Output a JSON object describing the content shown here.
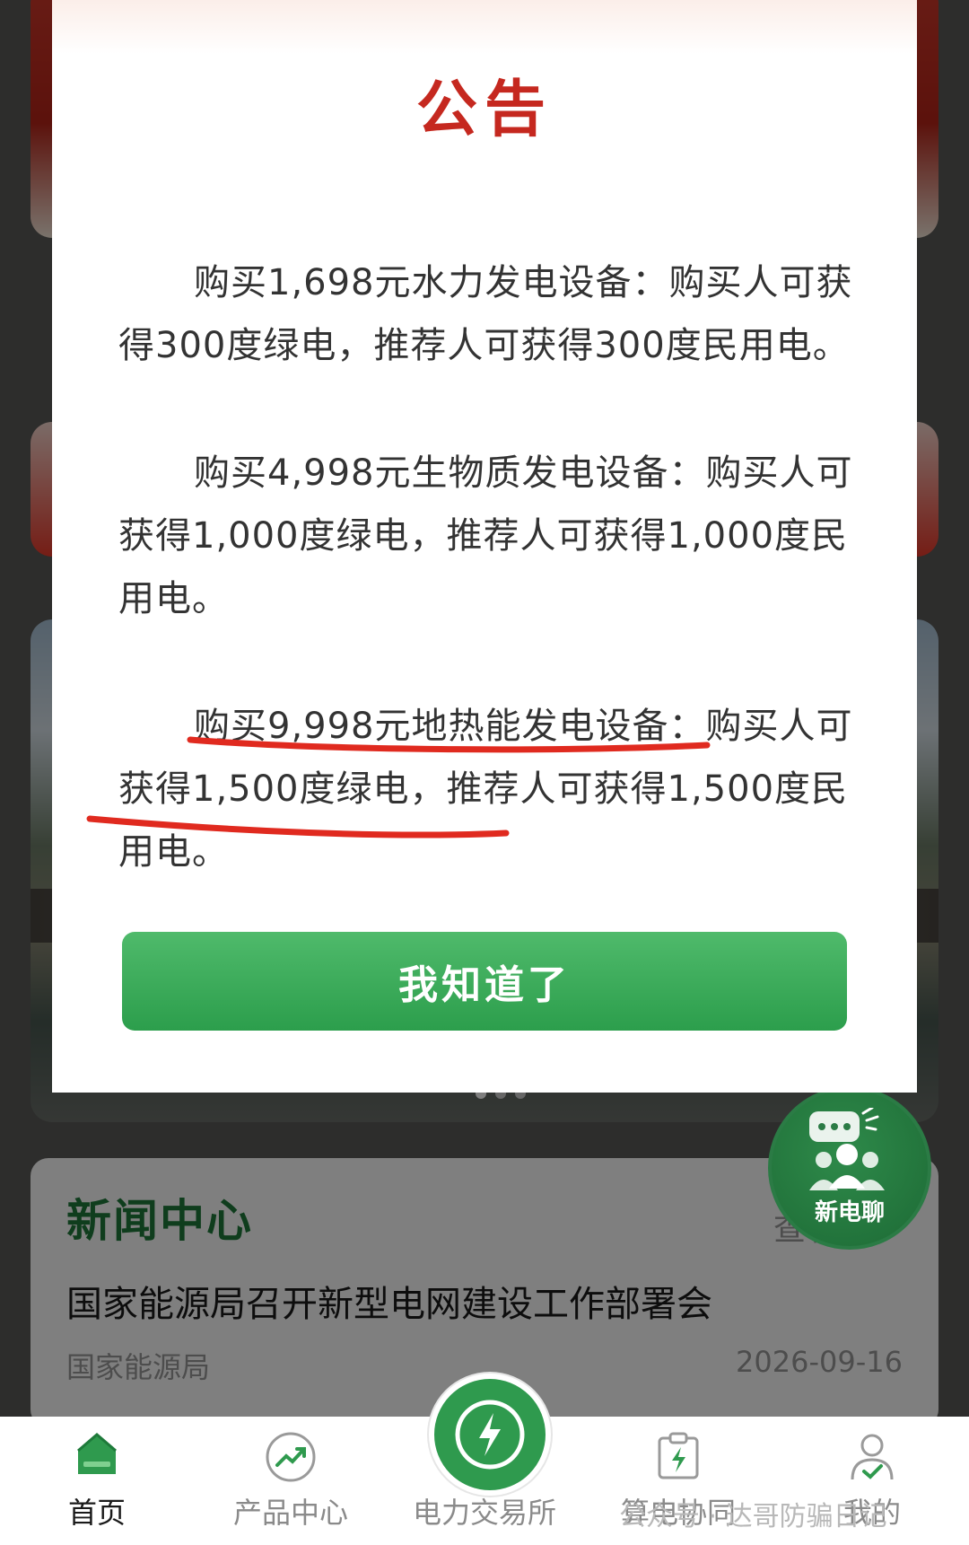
{
  "modal": {
    "title": "公告",
    "paragraphs": [
      "购买1,698元水力发电设备：购买人可获得300度绿电，推荐人可获得300度民用电。",
      "购买4,998元生物质发电设备：购买人可获得1,000度绿电，推荐人可获得1,000度民用电。",
      "购买9,998元地热能发电设备：购买人可获得1,500度绿电，推荐人可获得1,500度民用电。"
    ],
    "confirm_label": "我知道了"
  },
  "chat_fab": {
    "label": "新电聊"
  },
  "news": {
    "title": "新闻中心",
    "more_label": "查看更多",
    "headline": "国家能源局召开新型电网建设工作部署会",
    "source": "国家能源局",
    "date": "2026-09-16"
  },
  "tabs": [
    {
      "label": "首页",
      "icon": "home-icon",
      "active": true
    },
    {
      "label": "产品中心",
      "icon": "trend-chart-icon",
      "active": false
    },
    {
      "label": "电力交易所",
      "icon": "lightning-icon",
      "active": false
    },
    {
      "label": "算电协同",
      "icon": "clipboard-lightning-icon",
      "active": false
    },
    {
      "label": "我的",
      "icon": "user-check-icon",
      "active": false
    }
  ],
  "watermark": "公众号 · 达哥防骗日记",
  "colors": {
    "brand_green": "#2c9e4c",
    "title_red": "#c5281f",
    "annotation_red": "#e02a1f"
  }
}
